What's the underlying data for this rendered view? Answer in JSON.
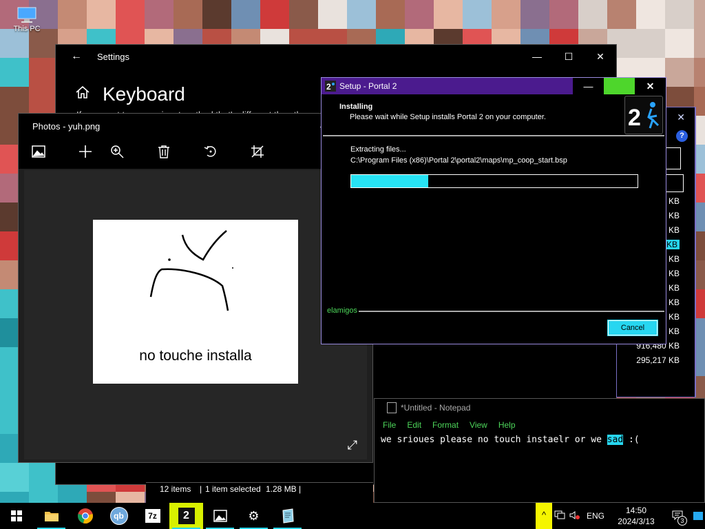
{
  "desktop": {
    "this_pc_label": "This PC"
  },
  "settings": {
    "title": "Settings",
    "back_glyph": "←",
    "heading": "Keyboard",
    "partial_text": "If you want to use an input method that's different than the",
    "min_glyph": "—",
    "max_glyph": "☐",
    "close_glyph": "✕"
  },
  "photos": {
    "title": "Photos - yuh.png",
    "min_glyph": "—",
    "max_glyph": "☐",
    "image_text": "no touche installa",
    "fullscreen_glyph": "⤢"
  },
  "setup": {
    "title": "Setup - Portal 2",
    "heading": "Installing",
    "subheading": "Please wait while Setup installs Portal 2 on your computer.",
    "extracting_label": "Extracting files...",
    "current_file": "C:\\Program Files (x86)\\Portal 2\\portal2\\maps\\mp_coop_start.bsp",
    "progress": 0.27,
    "brand": "elamigos",
    "cancel_label": "Cancel",
    "min_glyph": "—",
    "max_glyph": "☐",
    "close_glyph": "✕",
    "logo_text": "2"
  },
  "explorer": {
    "close_glyph": "✕",
    "help_glyph": "?",
    "sizes": [
      "KB",
      "KB",
      "KB",
      "KB",
      "KB",
      "KB",
      "KB",
      "KB",
      "KB",
      "KB",
      "916,480 KB",
      "295,217 KB"
    ],
    "selected_index": 3,
    "status_items": "12 items",
    "status_selected": "1 item selected",
    "status_size": "1.28 MB"
  },
  "notepad": {
    "title": "*Untitled - Notepad",
    "menu": [
      "File",
      "Edit",
      "Format",
      "View",
      "Help"
    ],
    "text_before": "we srioues please no touch instaelr or we ",
    "text_selected": "sad",
    "text_after": " :("
  },
  "taskbar": {
    "apps": [
      "file-explorer",
      "chrome",
      "qbittorrent",
      "7zip",
      "portal2-setup",
      "photos",
      "settings",
      "notepad"
    ],
    "qb_label": "qb",
    "sevenzip_label": "7z",
    "portal_label": "2",
    "chevron_glyph": "^",
    "language": "ENG",
    "time": "14:50",
    "date": "2024/3/13",
    "notification_count": "3"
  },
  "colors": {
    "accent": "#27d6f0",
    "setup_titlebar": "#4b1b8e",
    "green": "#4dd65a",
    "tray_highlight": "#f5f500"
  }
}
